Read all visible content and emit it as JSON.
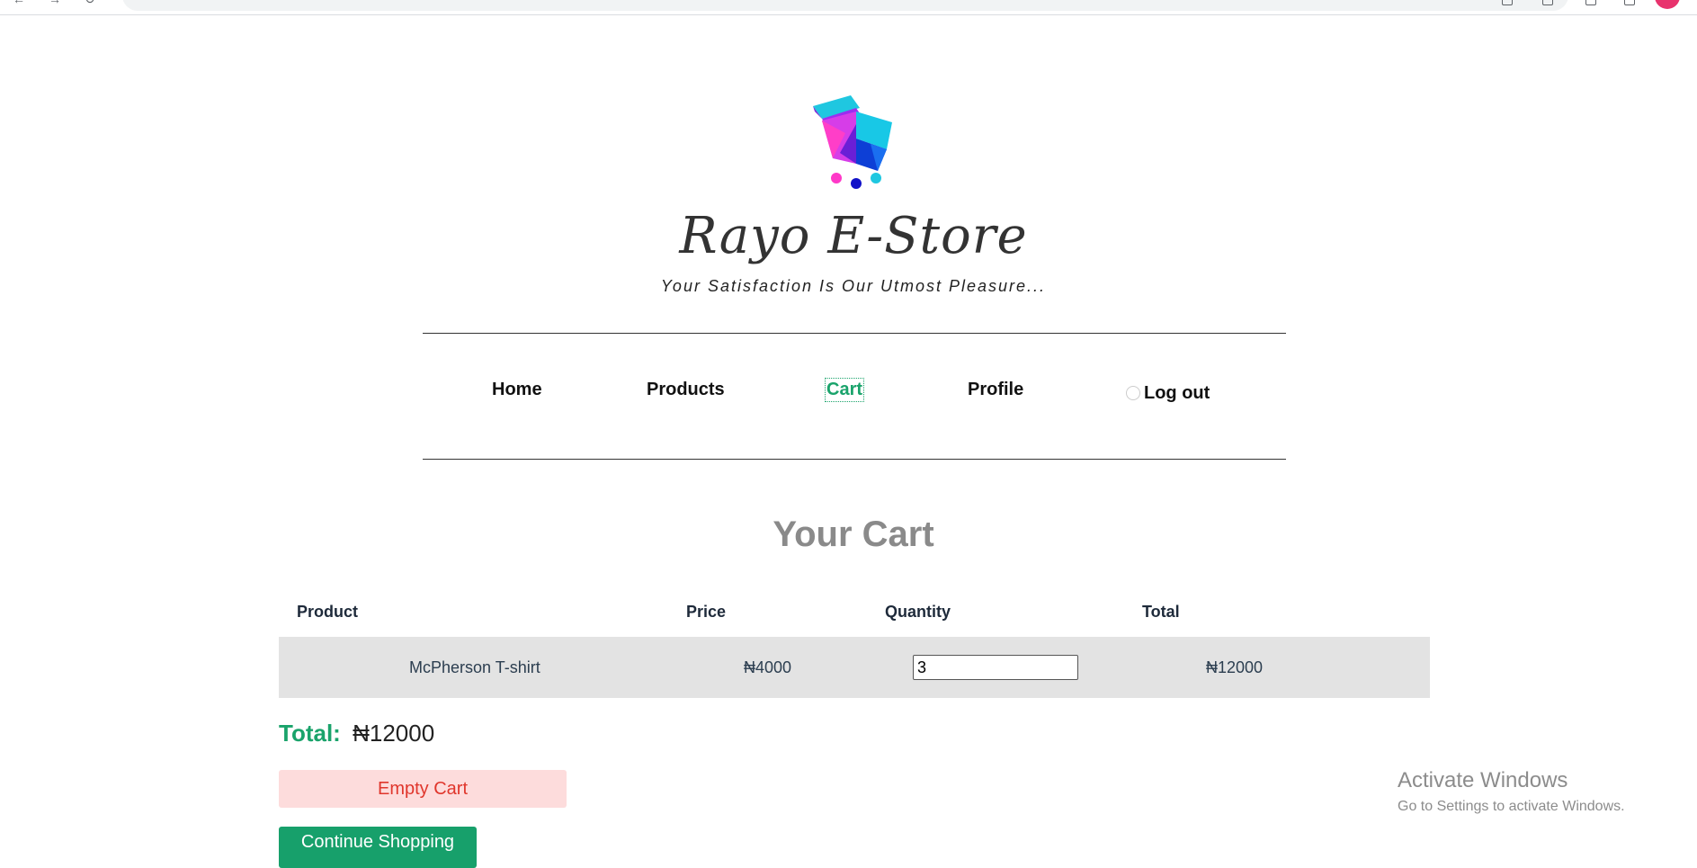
{
  "site": {
    "title": "Rayo E-Store",
    "tagline": "Your Satisfaction Is Our Utmost Pleasure..."
  },
  "nav": {
    "home": "Home",
    "products": "Products",
    "cart": "Cart",
    "profile": "Profile",
    "logout": "Log out",
    "active": "cart"
  },
  "cart": {
    "heading": "Your Cart",
    "columns": {
      "product": "Product",
      "price": "Price",
      "quantity": "Quantity",
      "total": "Total"
    },
    "items": [
      {
        "product": "McPherson T-shirt",
        "price": "₦4000",
        "quantity": "3",
        "total": "₦12000"
      }
    ],
    "total_label": "Total:",
    "total_value": "₦12000",
    "empty_button": "Empty Cart",
    "continue_button": "Continue Shopping"
  },
  "watermark": {
    "title": "Activate Windows",
    "subtitle": "Go to Settings to activate Windows."
  },
  "colors": {
    "accent": "#1aa36b",
    "danger_text": "#e0362c",
    "danger_bg": "#fddcdc",
    "heading_gray": "#8a8a8a",
    "row_bg": "#e3e3e3"
  },
  "icons": {
    "logo": "shopping-cart-logo-icon",
    "logout": "logout-icon"
  }
}
